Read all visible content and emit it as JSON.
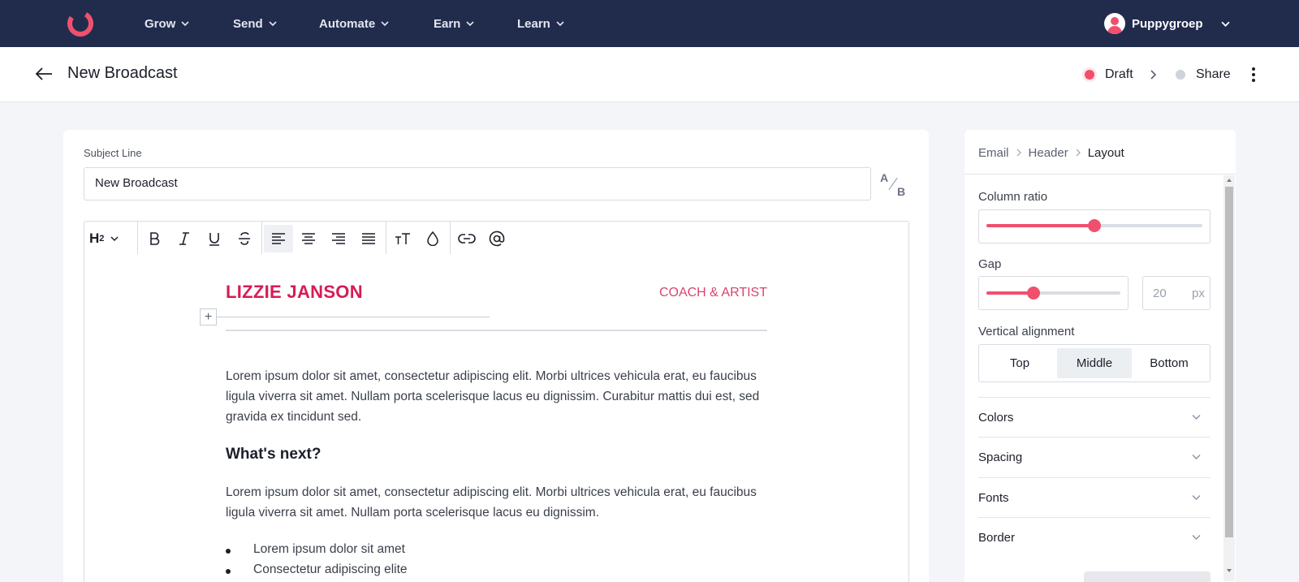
{
  "topnav": {
    "items": [
      {
        "label": "Grow"
      },
      {
        "label": "Send"
      },
      {
        "label": "Automate"
      },
      {
        "label": "Earn"
      },
      {
        "label": "Learn"
      }
    ],
    "user": "Puppygroep"
  },
  "header": {
    "title": "New Broadcast",
    "steps": [
      {
        "label": "Draft",
        "state": "current"
      },
      {
        "label": "Share",
        "state": "pending"
      }
    ]
  },
  "editor": {
    "subject_label": "Subject Line",
    "subject_value": "New Broadcast",
    "ab_a": "A",
    "ab_b": "B",
    "toolbar": {
      "heading_label": "H",
      "heading_level": "2",
      "buttons": [
        "bold-icon",
        "italic-icon",
        "underline-icon",
        "strikethrough-icon",
        "align-left-icon",
        "align-center-icon",
        "align-right-icon",
        "justify-icon",
        "text-size-icon",
        "color-drop-icon",
        "link-icon",
        "mention-icon"
      ],
      "active": "align-left-icon"
    },
    "content": {
      "brand": "LIZZIE JANSON",
      "tagline": "COACH & ARTIST",
      "add_glyph": "+",
      "para1": "Lorem ipsum dolor sit amet, consectetur adipiscing elit. Morbi ultrices vehicula erat, eu faucibus ligula viverra sit amet. Nullam porta scelerisque lacus eu dignissim. Curabitur mattis dui est, sed gravida ex tincidunt sed.",
      "heading": "What's next?",
      "para2": "Lorem ipsum dolor sit amet, consectetur adipiscing elit. Morbi ultrices vehicula erat, eu faucibus ligula viverra sit amet. Nullam porta scelerisque lacus eu dignissim.",
      "bullets": [
        "Lorem ipsum dolor sit amet",
        "Consectetur adipiscing elite"
      ]
    }
  },
  "panel": {
    "breadcrumb": [
      "Email",
      "Header",
      "Layout"
    ],
    "column_ratio": {
      "label": "Column ratio",
      "value_fraction": 0.5
    },
    "gap": {
      "label": "Gap",
      "value": "20",
      "unit": "px",
      "value_fraction": 0.35
    },
    "vertical_alignment": {
      "label": "Vertical alignment",
      "options": [
        "Top",
        "Middle",
        "Bottom"
      ],
      "selected": "Middle"
    },
    "sections": [
      "Colors",
      "Spacing",
      "Fonts",
      "Border"
    ]
  },
  "colors": {
    "nav_bg": "#212c4d",
    "accent": "#f0506e",
    "brand_text": "#d81b54"
  }
}
